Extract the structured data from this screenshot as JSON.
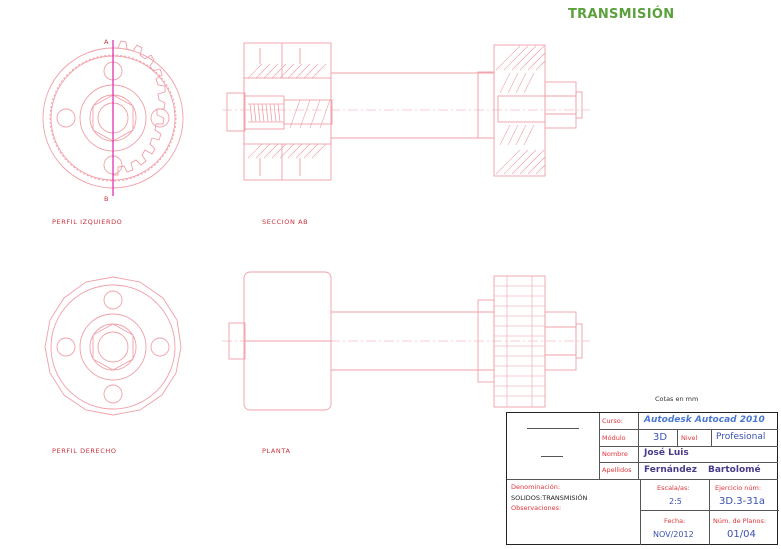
{
  "drawing": {
    "title": "TRANSMISIÓN",
    "note": "Cotas en mm",
    "views": {
      "left_profile": "PERFIL IZQUIERDO",
      "section": "SECCION AB",
      "right_profile": "PERFIL DERECHO",
      "plan": "PLANTA"
    },
    "section_marks": {
      "a": "A",
      "b": "B"
    }
  },
  "title_block": {
    "course_label": "Curso:",
    "course_value": "Autodesk Autocad 2010",
    "module_label": "Módulo",
    "module_value": "3D",
    "level_label": "Nivel",
    "level_value": "Profesional",
    "name_label": "Nombre",
    "name_value": "José Luis",
    "surname_label": "Apellidos",
    "surname_value_1": "Fernández",
    "surname_value_2": "Bartolomé",
    "denomination_label": "Denominación:",
    "denomination_value": "SOLIDOS:TRANSMISIÓN",
    "observations_label": "Observaciones:",
    "scale_label": "Escala/as:",
    "scale_value": "2:5",
    "exercise_label": "Ejercicio núm:",
    "exercise_value": "3D.3-31a",
    "date_label": "Fecha:",
    "date_value": "NOV/2012",
    "sheets_label": "Núm. de Planos:",
    "sheets_value": "01/04"
  },
  "colors": {
    "line": "#f0a0a8",
    "title": "#5aa03c",
    "axis": "#e020b0",
    "label_red": "#e0343a",
    "value_blue": "#3a52b0"
  }
}
